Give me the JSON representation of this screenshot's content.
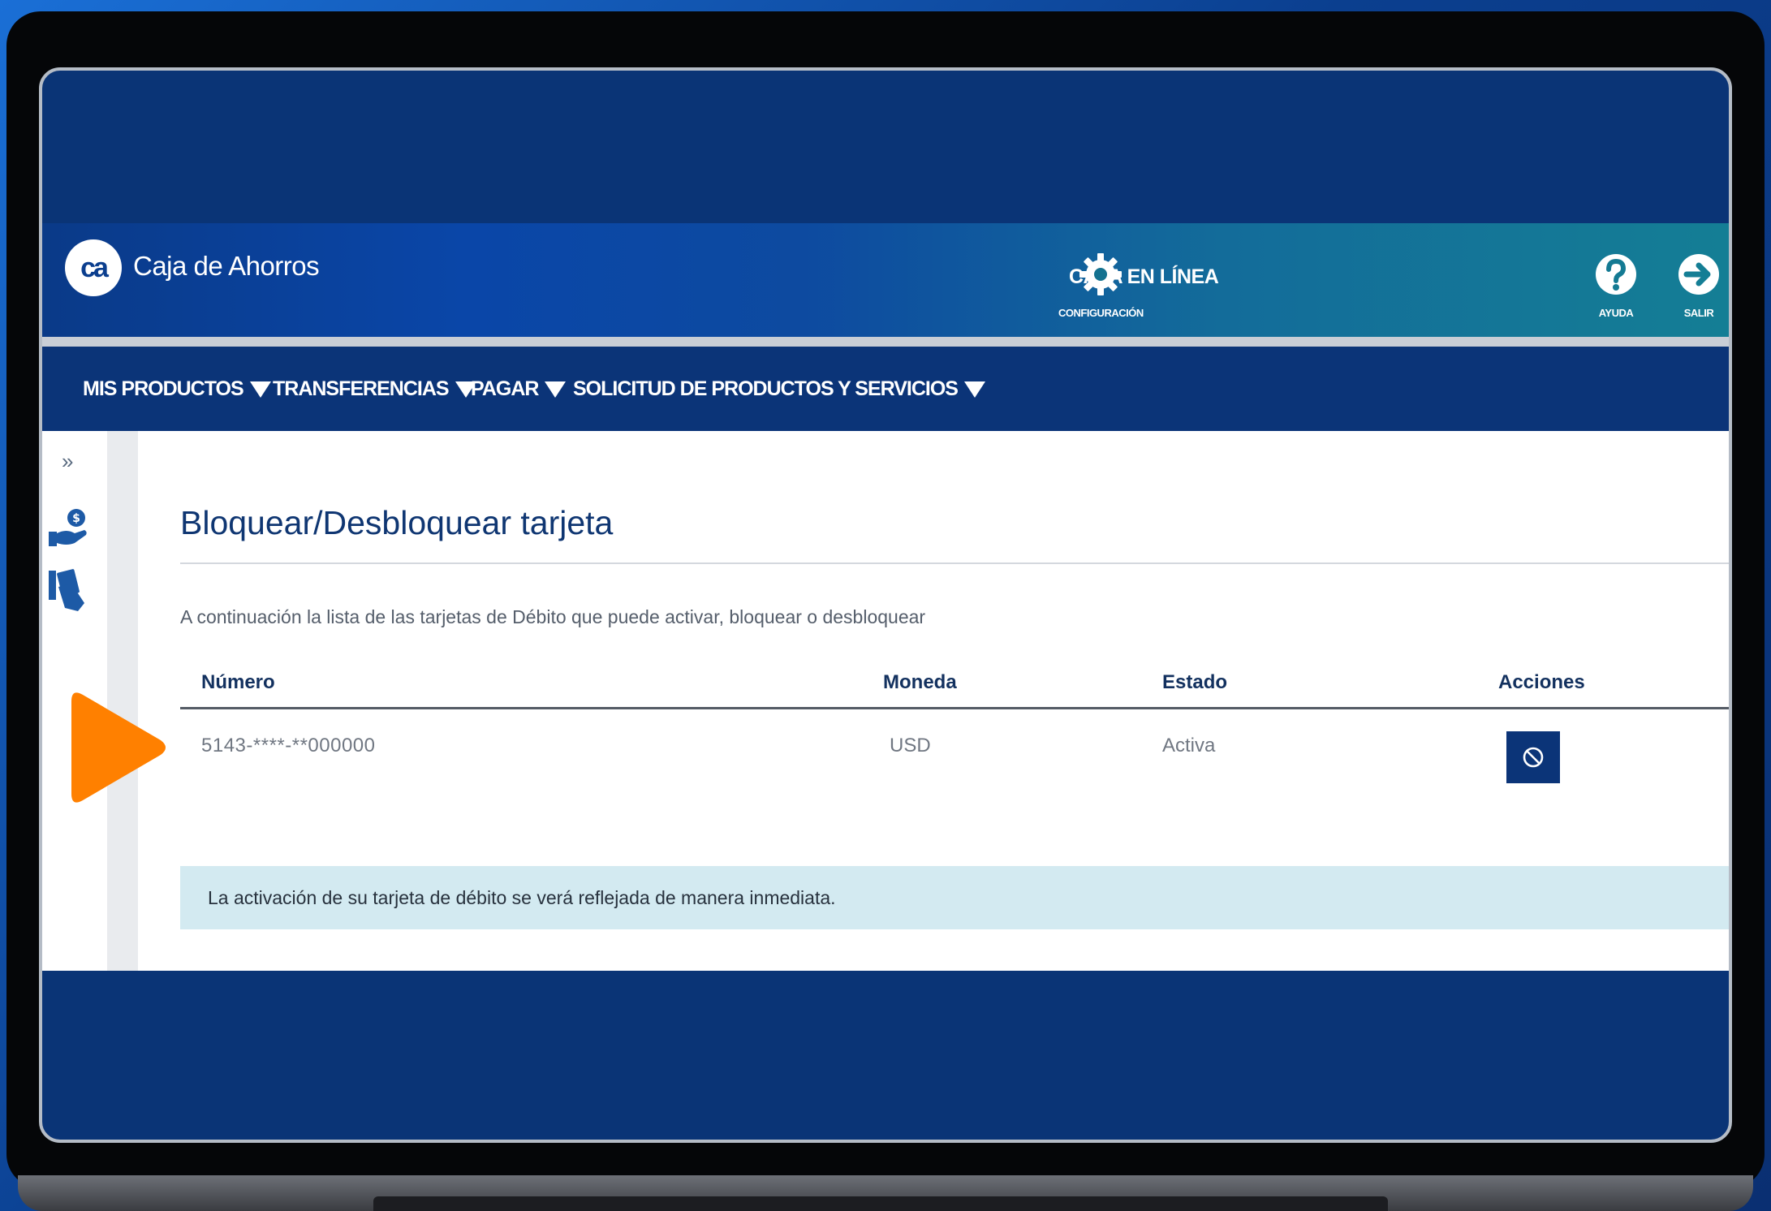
{
  "header": {
    "brand_logo_text": "ca",
    "brand_name": "Caja de Ahorros",
    "title": "CAJA EN LÍNEA",
    "actions": [
      {
        "label": "CONFIGURACIÓN",
        "icon": "gear-icon"
      },
      {
        "label": "AYUDA",
        "icon": "help-icon"
      },
      {
        "label": "SALIR",
        "icon": "logout-icon"
      }
    ]
  },
  "nav": {
    "items": [
      {
        "label": "MIS PRODUCTOS"
      },
      {
        "label": "TRANSFERENCIAS"
      },
      {
        "label": "PAGAR"
      },
      {
        "label": "SOLICITUD DE PRODUCTOS Y SERVICIOS"
      }
    ]
  },
  "sidebar": {
    "expand_glyph": "»",
    "icons": [
      "money-hand-icon",
      "card-hand-icon"
    ]
  },
  "page": {
    "title": "Bloquear/Desbloquear tarjeta",
    "description": "A continuación la lista de las tarjetas de Débito que puede activar, bloquear o desbloquear",
    "table": {
      "headers": [
        "Número",
        "Moneda",
        "Estado",
        "Acciones"
      ],
      "rows": [
        {
          "numero": "5143-****-**000000",
          "moneda": "USD",
          "estado": "Activa",
          "action_icon": "block-icon"
        }
      ]
    },
    "info_message": "La activación de su tarjeta de débito se verá reflejada de manera inmediata."
  },
  "colors": {
    "navy": "#0b3478",
    "title_blue": "#0f3672",
    "info_bg": "#d3eaf1",
    "marker_orange": "#ff8000"
  }
}
